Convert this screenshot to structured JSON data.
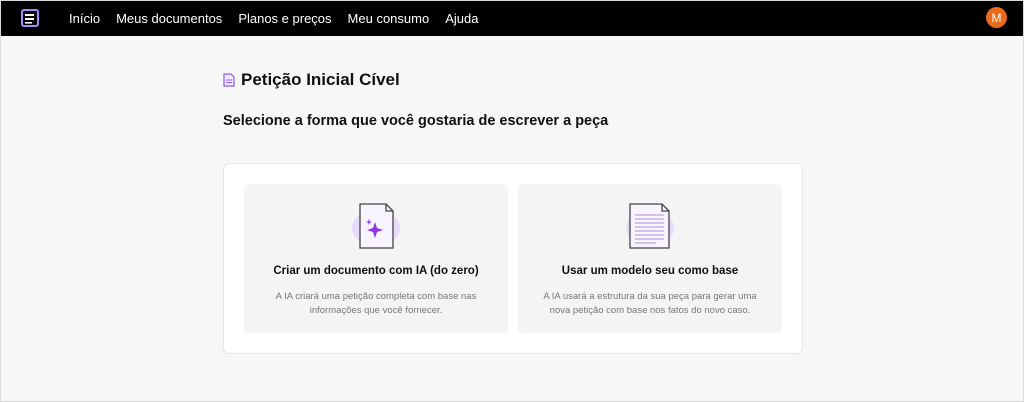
{
  "nav": {
    "items": [
      "Início",
      "Meus documentos",
      "Planos e preços",
      "Meu consumo",
      "Ajuda"
    ],
    "avatar_initial": "M"
  },
  "page": {
    "title": "Petição Inicial Cível",
    "subtitle": "Selecione a forma que você gostaria de escrever a peça"
  },
  "options": [
    {
      "title": "Criar um documento com IA (do zero)",
      "description": "A IA criará uma petição completa com base nas informações que você fornecer.",
      "icon": "sparkle-document-icon"
    },
    {
      "title": "Usar um modelo seu como base",
      "description": "A IA usará a estrutura da sua peça para gerar uma nova petição com base nos fatos do novo caso.",
      "icon": "lined-document-icon"
    }
  ],
  "colors": {
    "topbar": "#000000",
    "accent_purple": "#8b5cf6",
    "avatar": "#ea6a1e"
  }
}
